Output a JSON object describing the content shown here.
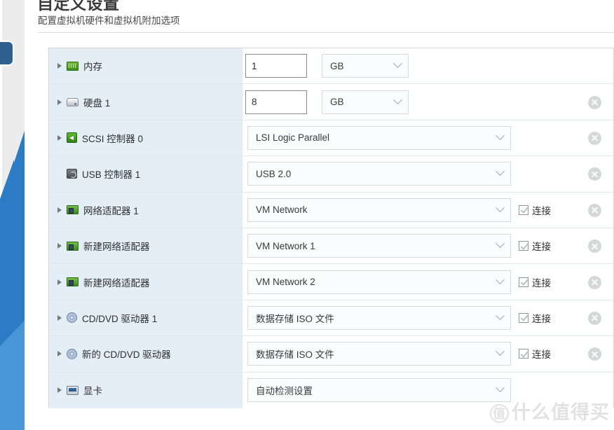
{
  "page": {
    "title": "自定义设置",
    "subtitle": "配置虚拟机硬件和虚拟机附加选项"
  },
  "labels": {
    "connect": "连接"
  },
  "rows": [
    {
      "name": "内存",
      "icon": "memory-icon",
      "icon_class": "ic-memory",
      "expandable": true,
      "control": "number-unit",
      "value": "1",
      "unit": "GB",
      "checkbox": false,
      "removable": false
    },
    {
      "name": "硬盘 1",
      "icon": "hard-disk-icon",
      "icon_class": "ic-disk",
      "expandable": true,
      "control": "number-unit",
      "value": "8",
      "unit": "GB",
      "checkbox": false,
      "removable": true
    },
    {
      "name": "SCSI 控制器 0",
      "icon": "scsi-controller-icon",
      "icon_class": "ic-scsi",
      "expandable": true,
      "control": "select",
      "value": "LSI Logic Parallel",
      "checkbox": false,
      "removable": true
    },
    {
      "name": "USB 控制器 1",
      "icon": "usb-controller-icon",
      "icon_class": "ic-usb",
      "expandable": false,
      "control": "select",
      "value": "USB 2.0",
      "checkbox": false,
      "removable": true
    },
    {
      "name": "网络适配器 1",
      "icon": "network-adapter-icon",
      "icon_class": "ic-net",
      "expandable": true,
      "control": "select",
      "value": "VM Network",
      "checkbox": true,
      "checked": true,
      "removable": true
    },
    {
      "name": "新建网络适配器",
      "icon": "network-adapter-icon",
      "icon_class": "ic-net",
      "expandable": true,
      "control": "select",
      "value": "VM Network 1",
      "checkbox": true,
      "checked": true,
      "removable": true
    },
    {
      "name": "新建网络适配器",
      "icon": "network-adapter-icon",
      "icon_class": "ic-net",
      "expandable": true,
      "control": "select",
      "value": "VM Network 2",
      "checkbox": true,
      "checked": true,
      "removable": true
    },
    {
      "name": "CD/DVD 驱动器 1",
      "icon": "cd-dvd-drive-icon",
      "icon_class": "ic-cd",
      "expandable": true,
      "control": "select",
      "value": "数据存储 ISO 文件",
      "checkbox": true,
      "checked": true,
      "removable": true
    },
    {
      "name": "新的 CD/DVD 驱动器",
      "icon": "cd-dvd-drive-icon",
      "icon_class": "ic-cd",
      "expandable": true,
      "control": "select",
      "value": "数据存储 ISO 文件",
      "checkbox": true,
      "checked": true,
      "removable": true
    },
    {
      "name": "显卡",
      "icon": "video-card-icon",
      "icon_class": "ic-video",
      "expandable": true,
      "control": "select",
      "value": "自动检测设置",
      "checkbox": false,
      "removable": false
    }
  ],
  "watermark": {
    "badge": "值",
    "text": "什么值得买"
  },
  "colors": {
    "label_column_bg": "#e4eef6",
    "rail_blue": "#2b7cc4",
    "rail_blue_light": "#4a95d6",
    "rail_chip": "#2e5f8f",
    "border": "#d4d4d4"
  }
}
